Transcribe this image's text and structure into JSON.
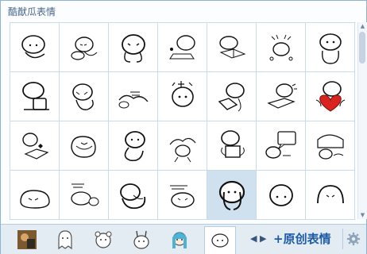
{
  "panel": {
    "title": "酷猷瓜表情"
  },
  "emoticons": [
    "emoticon-01",
    "emoticon-02",
    "emoticon-03",
    "emoticon-04",
    "emoticon-05",
    "emoticon-06",
    "emoticon-07",
    "emoticon-08",
    "emoticon-09",
    "emoticon-10",
    "emoticon-11",
    "emoticon-12",
    "emoticon-13",
    "emoticon-14",
    "emoticon-15",
    "emoticon-16",
    "emoticon-17",
    "emoticon-18",
    "emoticon-19",
    "emoticon-20",
    "emoticon-21",
    "emoticon-22",
    "emoticon-23",
    "emoticon-24",
    "emoticon-25",
    "emoticon-26",
    "emoticon-27",
    "emoticon-28"
  ],
  "selected_index": 25,
  "tabs": [
    "tab-1",
    "tab-2",
    "tab-3",
    "tab-4",
    "tab-5",
    "tab-6",
    "tab-7"
  ],
  "active_tab_index": 6,
  "footer": {
    "nav_prev": "◀",
    "nav_next": "▶",
    "create_label": "+原创表情"
  },
  "colors": {
    "border": "#8fb3d2",
    "title": "#4b6688",
    "link": "#1e5ca6",
    "selected_cell": "#cfe0ef",
    "heart": "#d8231e"
  }
}
